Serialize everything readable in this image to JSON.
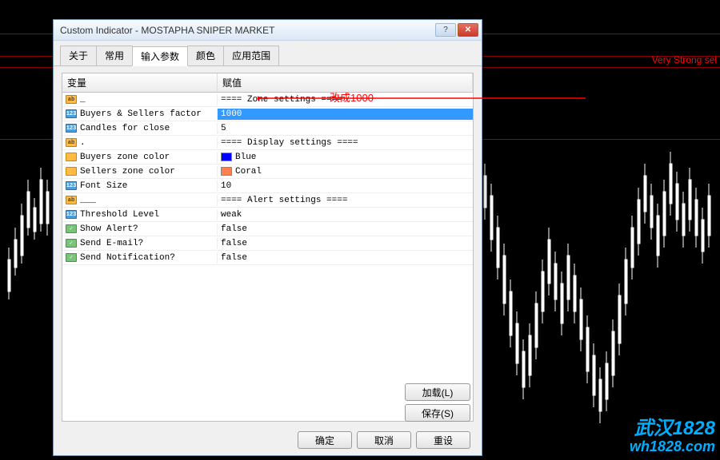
{
  "chart": {
    "label": "Very Strong sel"
  },
  "dialog": {
    "title": "Custom Indicator - MOSTAPHA SNIPER MARKET",
    "tabs": [
      "关于",
      "常用",
      "输入参数",
      "颜色",
      "应用范围"
    ],
    "active_tab": 2,
    "columns": {
      "name": "变量",
      "value": "赋值"
    },
    "rows": [
      {
        "icon": "ab",
        "name": "_",
        "value": "==== Zone settings ===="
      },
      {
        "icon": "123",
        "name": "Buyers & Sellers factor",
        "value": "1000",
        "highlight": true
      },
      {
        "icon": "123",
        "name": "Candles for close",
        "value": "5"
      },
      {
        "icon": "ab",
        "name": ".",
        "value": "==== Display settings ===="
      },
      {
        "icon": "color",
        "name": "Buyers zone color",
        "value": "Blue",
        "swatch": "#0000ff"
      },
      {
        "icon": "color",
        "name": "Sellers zone color",
        "value": "Coral",
        "swatch": "#ff7f50"
      },
      {
        "icon": "123",
        "name": "Font Size",
        "value": "10"
      },
      {
        "icon": "ab",
        "name": "___",
        "value": "==== Alert settings ===="
      },
      {
        "icon": "123",
        "name": "Threshold Level",
        "value": "weak"
      },
      {
        "icon": "bool",
        "name": "Show Alert?",
        "value": "false"
      },
      {
        "icon": "bool",
        "name": "Send E-mail?",
        "value": "false"
      },
      {
        "icon": "bool",
        "name": "Send Notification?",
        "value": "false"
      }
    ],
    "buttons": {
      "load": "加载(L)",
      "save": "保存(S)",
      "ok": "确定",
      "cancel": "取消",
      "reset": "重设"
    }
  },
  "annotation": "改成1000",
  "watermark": {
    "line1": "武汉1828",
    "line2": "wh1828.com"
  }
}
